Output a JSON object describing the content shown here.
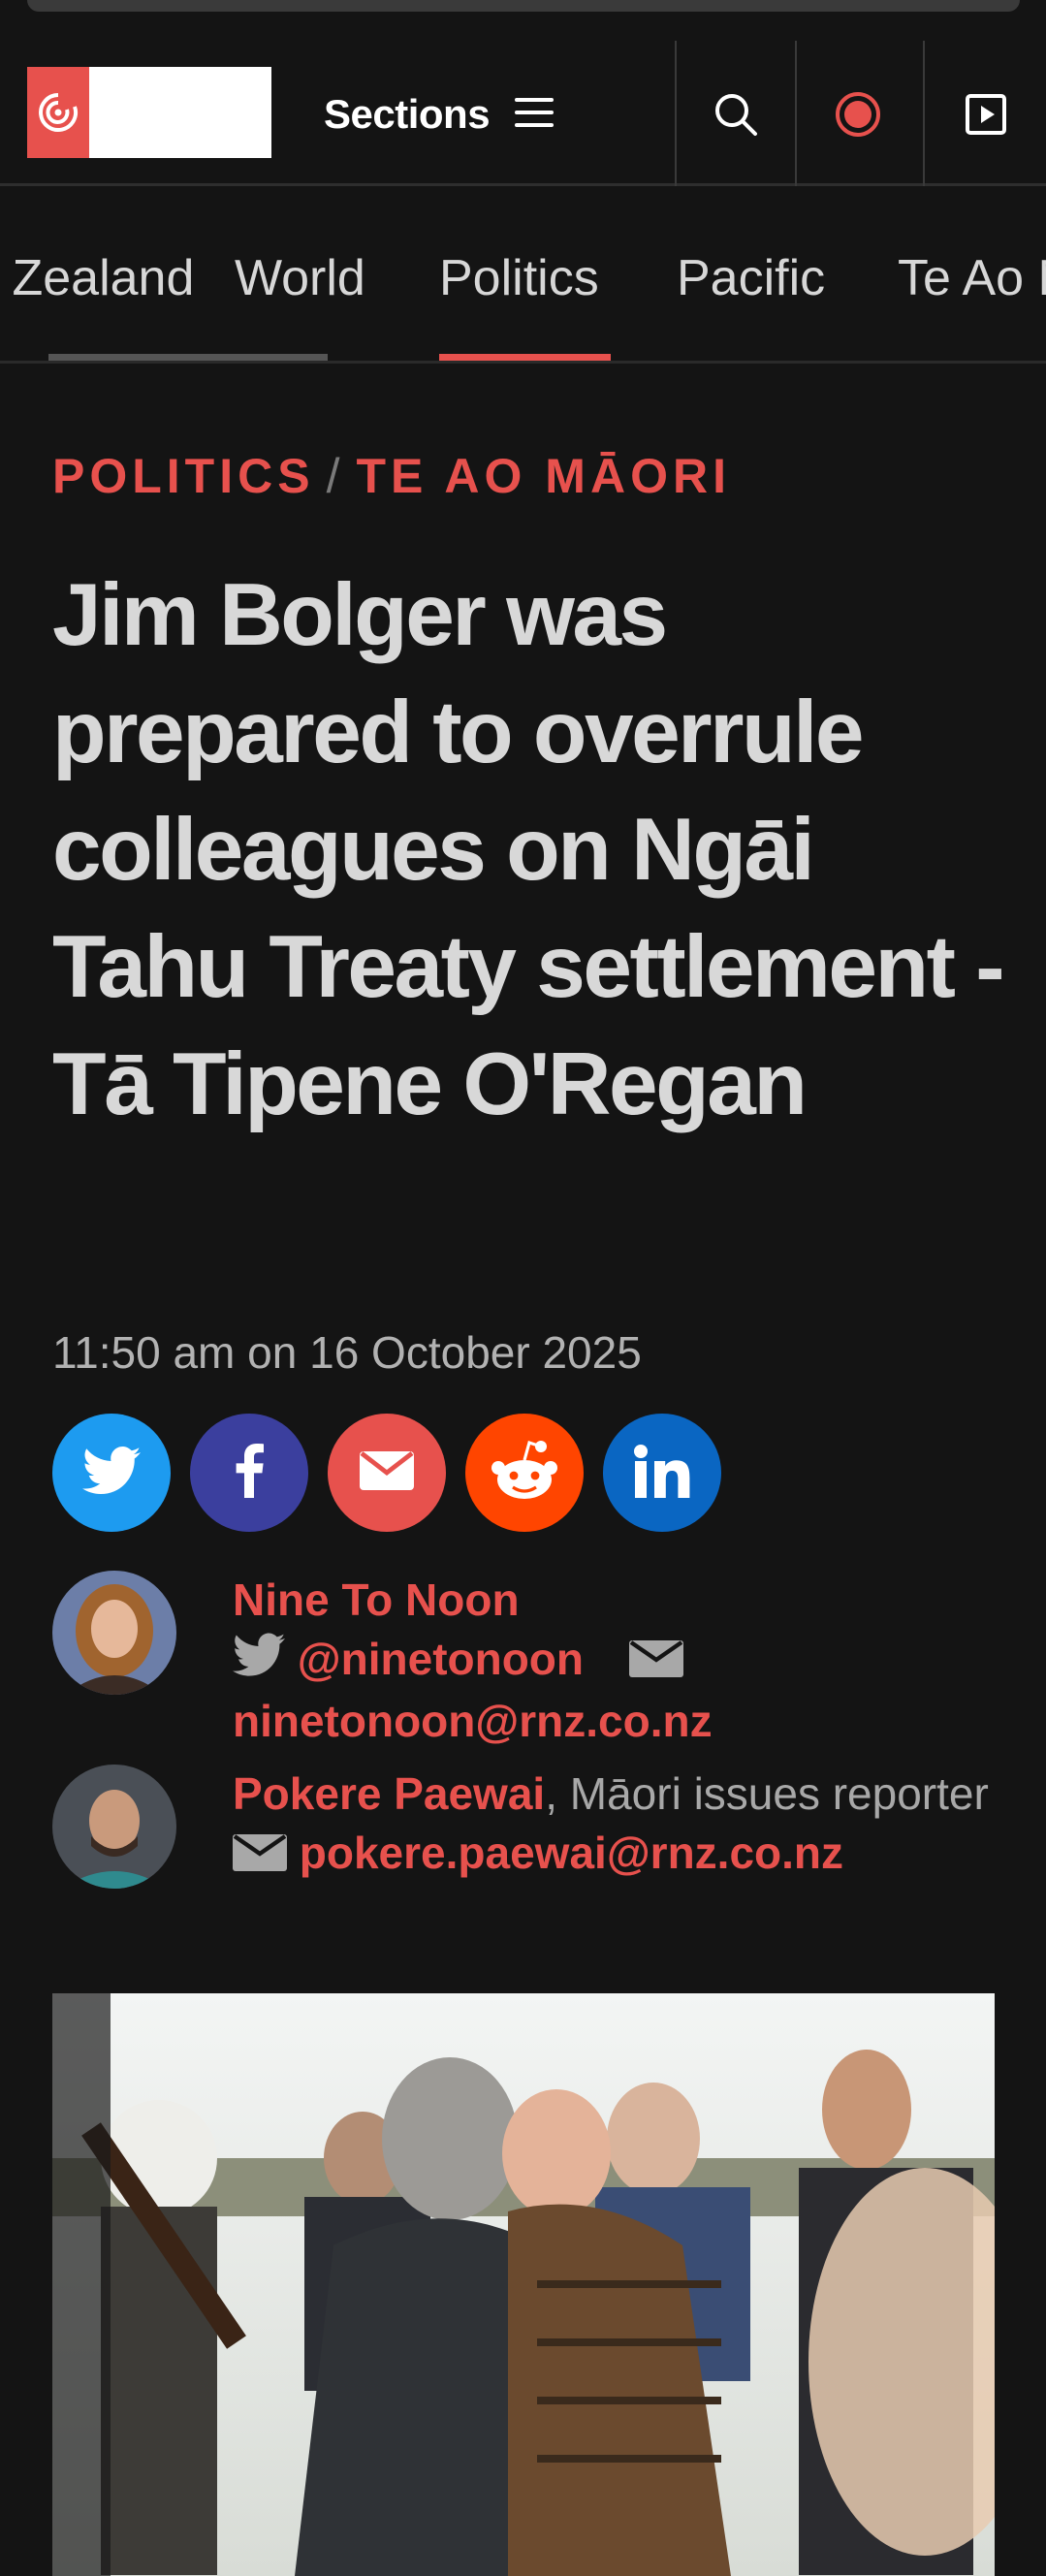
{
  "header": {
    "sections_label": "Sections"
  },
  "nav": {
    "tabs": [
      {
        "label": "New Zealand"
      },
      {
        "label": "World"
      },
      {
        "label": "Politics"
      },
      {
        "label": "Pacific"
      },
      {
        "label": "Te Ao Māori"
      }
    ],
    "active_tab": "Politics"
  },
  "article": {
    "kicker_1": "POLITICS",
    "kicker_sep": "/",
    "kicker_2": "TE AO MĀORI",
    "headline": "Jim Bolger was prepared to overrule colleagues on Ngāi Tahu Treaty settlement - Tā Tipene O'Regan",
    "dateline": "11:50 am on 16 October 2025"
  },
  "share": [
    {
      "name": "twitter-icon",
      "color": "#1d9bf0"
    },
    {
      "name": "facebook-icon",
      "color": "#3b3f9e"
    },
    {
      "name": "email-icon",
      "color": "#e7514d"
    },
    {
      "name": "reddit-icon",
      "color": "#ff4500"
    },
    {
      "name": "linkedin-icon",
      "color": "#0a66c2"
    }
  ],
  "authors": [
    {
      "name": "Nine To Noon",
      "twitter": "@ninetonoon",
      "email": "ninetonoon@rnz.co.nz"
    },
    {
      "name": "Pokere Paewai",
      "role": ", Māori issues reporter",
      "email": "pokere.paewai@rnz.co.nz"
    }
  ],
  "colors": {
    "accent": "#e7514d",
    "background": "#141414",
    "text": "#d8d8d8"
  }
}
